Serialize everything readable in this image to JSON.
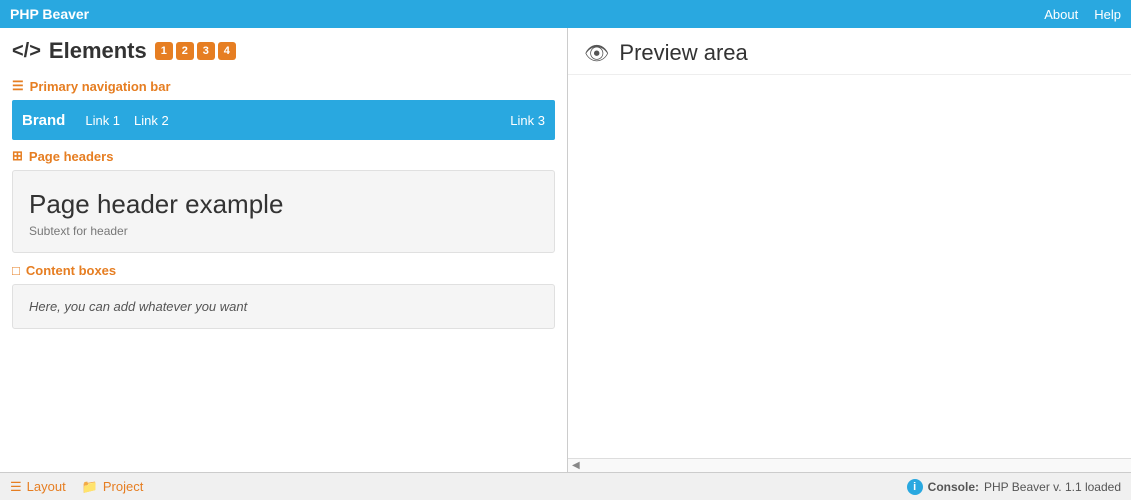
{
  "topbar": {
    "title": "PHP Beaver",
    "about_label": "About",
    "help_label": "Help"
  },
  "left_panel": {
    "heading": "Elements",
    "heading_icon": "</>",
    "badges": [
      "1",
      "2",
      "3",
      "4"
    ],
    "sections": [
      {
        "id": "primary-nav",
        "icon": "☰",
        "label": "Primary navigation bar",
        "navbar": {
          "brand": "Brand",
          "links": [
            "Link 1",
            "Link 2"
          ],
          "links_right": [
            "Link 3"
          ]
        }
      },
      {
        "id": "page-headers",
        "icon": "⊞",
        "label": "Page headers",
        "page_header": {
          "title": "Page header example",
          "subtext": "Subtext for header"
        }
      },
      {
        "id": "content-boxes",
        "icon": "□",
        "label": "Content boxes",
        "content": "Here, you can add whatever you want"
      }
    ]
  },
  "right_panel": {
    "heading": "Preview area",
    "eye_icon": "👁"
  },
  "bottombar": {
    "items": [
      {
        "icon": "☰",
        "label": "Layout"
      },
      {
        "icon": "📁",
        "label": "Project"
      }
    ],
    "console_icon": "ℹ",
    "console_label": "Console:",
    "console_message": "PHP Beaver v. 1.1 loaded"
  }
}
